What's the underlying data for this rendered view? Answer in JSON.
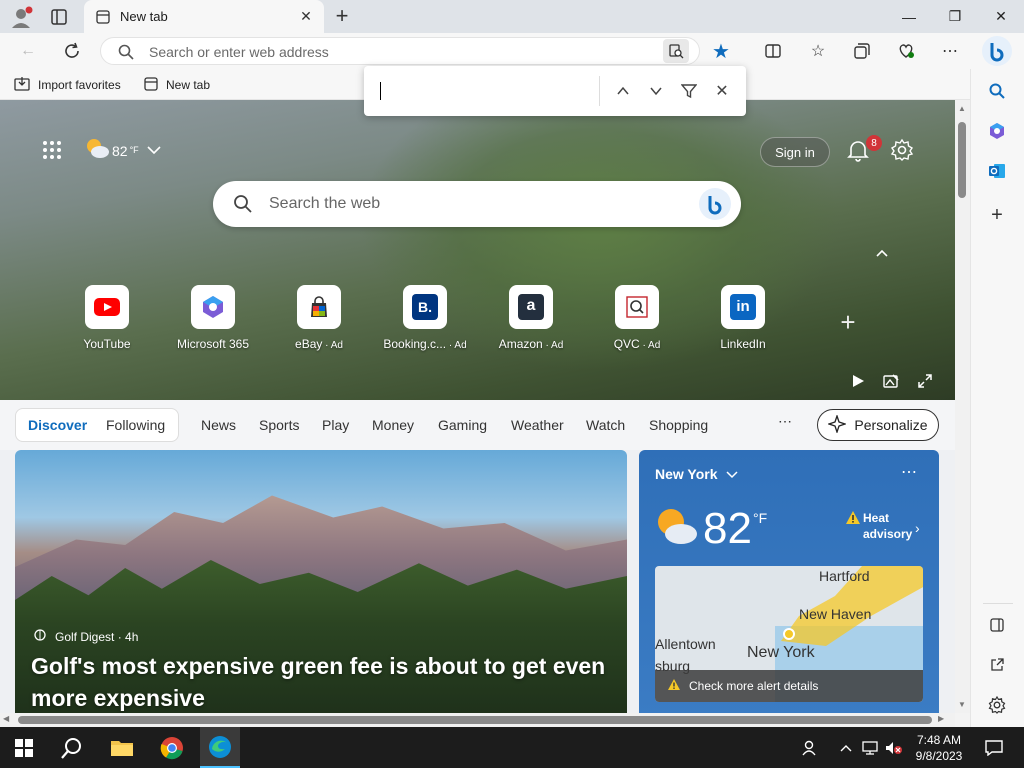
{
  "browser": {
    "tab_title": "New tab",
    "address_placeholder": "Search or enter web address",
    "favorites": [
      {
        "label": "Import favorites"
      },
      {
        "label": "New tab"
      }
    ]
  },
  "hero": {
    "weather_temp": "82",
    "weather_unit": "°F",
    "sign_in_label": "Sign in",
    "notification_count": "8",
    "search_placeholder": "Search the web",
    "tiles": [
      {
        "label": "YouTube",
        "ad": ""
      },
      {
        "label": "Microsoft 365",
        "ad": ""
      },
      {
        "label": "eBay",
        "ad": " · Ad"
      },
      {
        "label": "Booking.c...",
        "ad": " · Ad"
      },
      {
        "label": "Amazon",
        "ad": " · Ad"
      },
      {
        "label": "QVC",
        "ad": " · Ad"
      },
      {
        "label": "LinkedIn",
        "ad": ""
      }
    ]
  },
  "feed_nav": {
    "items": [
      "Discover",
      "Following",
      "News",
      "Sports",
      "Play",
      "Money",
      "Gaming",
      "Weather",
      "Watch",
      "Shopping"
    ],
    "personalize_label": "Personalize"
  },
  "news": {
    "source": "Golf Digest · 4h",
    "title": "Golf's most expensive green fee is about to get even more expensive"
  },
  "weather_card": {
    "location": "New York",
    "temp": "82",
    "unit": "°F",
    "advisory": "Heat advisory",
    "map_labels": [
      "Hartford",
      "New Haven",
      "Allentown",
      "New York",
      "sburg"
    ],
    "alert_text": "Check more alert details"
  },
  "taskbar": {
    "time": "7:48 AM",
    "date": "9/8/2023"
  },
  "colors": {
    "accent": "#0f6cbd",
    "weather_card": "#2f6fb8",
    "alert_yellow": "#f5c828"
  }
}
